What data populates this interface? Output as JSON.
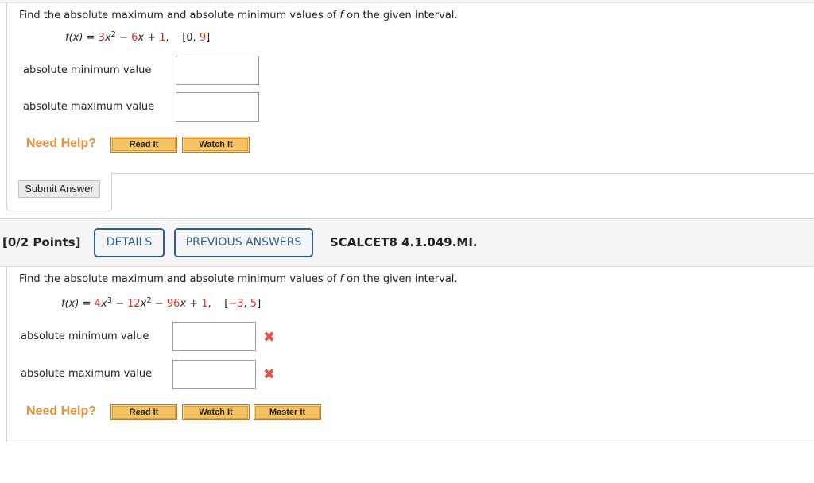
{
  "question1": {
    "prompt": "Find the absolute maximum and absolute minimum values of f on the given interval.",
    "prompt_parts": {
      "before": "Find the absolute maximum and absolute minimum values of ",
      "var": "f",
      "after": " on the given interval."
    },
    "formula": {
      "lhs": "f(x) = ",
      "terms": [
        {
          "coef": "3",
          "base": "x",
          "exp": "2"
        },
        {
          "sep": " − ",
          "coef": "6",
          "base": "x"
        },
        {
          "sep": " + ",
          "coef": "1"
        }
      ],
      "interval_open": "[0, ",
      "interval_end": "9",
      "interval_close": "]"
    },
    "fields": [
      {
        "label": "absolute minimum value",
        "value": ""
      },
      {
        "label": "absolute maximum value",
        "value": ""
      }
    ],
    "need_help_label": "Need Help?",
    "help_buttons": [
      "Read It",
      "Watch It"
    ],
    "submit_label": "Submit Answer"
  },
  "question2": {
    "points_label": "[0/2 Points]",
    "details_label": "DETAILS",
    "previous_answers_label": "PREVIOUS ANSWERS",
    "problem_code": "SCALCET8 4.1.049.MI.",
    "prompt_parts": {
      "before": "Find the absolute maximum and absolute minimum values of ",
      "var": "f",
      "after": " on the given interval."
    },
    "formula": {
      "lhs": "f(x) = ",
      "c1": "4",
      "e1": "3",
      "c2": "12",
      "e2": "2",
      "c3": "96",
      "c4": "1",
      "interval_start": "−3",
      "interval_end": "5"
    },
    "fields": [
      {
        "label": "absolute minimum value",
        "value": "",
        "status": "incorrect",
        "status_icon": "x-mark-icon"
      },
      {
        "label": "absolute maximum value",
        "value": "",
        "status": "incorrect",
        "status_icon": "x-mark-icon"
      }
    ],
    "need_help_label": "Need Help?",
    "help_buttons": [
      "Read It",
      "Watch It",
      "Master It"
    ]
  },
  "colors": {
    "coefficient_red": "#e8291c",
    "need_help_orange": "#e3913a",
    "help_button_fill": "#f5c262",
    "outline_button_blue": "#2d5f8b",
    "incorrect_red": "#e8504a"
  }
}
